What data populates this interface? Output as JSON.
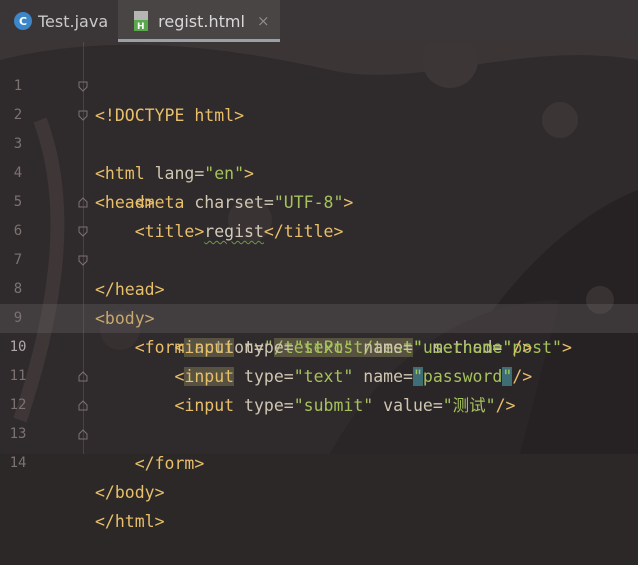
{
  "tabs": [
    {
      "label": "Test.java",
      "icon": "java-class-icon",
      "active": false,
      "close": ""
    },
    {
      "label": "regist.html",
      "icon": "html-file-icon",
      "active": true,
      "close": "×"
    }
  ],
  "editor": {
    "lines": [
      {
        "num": "1"
      },
      {
        "num": "2"
      },
      {
        "num": "3"
      },
      {
        "num": "4"
      },
      {
        "num": "5"
      },
      {
        "num": "6"
      },
      {
        "num": "7"
      },
      {
        "num": "8"
      },
      {
        "num": "9"
      },
      {
        "num": "10"
      },
      {
        "num": "11"
      },
      {
        "num": "12"
      },
      {
        "num": "13"
      },
      {
        "num": "14"
      }
    ],
    "current_line": "10",
    "code": {
      "doctype": "<!DOCTYPE html>",
      "html_open": "<html",
      "lang_attr": "lang",
      "lang_val": "\"en\"",
      "html_close_bracket": ">",
      "head_open": "<head>",
      "meta_open": "<meta",
      "charset_attr": "charset",
      "charset_val": "\"UTF-8\"",
      "meta_close": ">",
      "title_open": "<title>",
      "title_text": "regist",
      "title_close": "</title>",
      "head_close": "</head>",
      "body_open": "<body>",
      "form_open": "<form",
      "action_attr": "action",
      "action_val_q1": "\"",
      "action_val": "/testPost/test",
      "action_val_q2": "\"",
      "method_attr": "method",
      "method_val": "\"post\"",
      "form_open_close": ">",
      "input_lt": "<",
      "input_tag": "input",
      "type_attr": "type",
      "type_text": "\"text\"",
      "name_attr": "name",
      "name_username": "\"username\"",
      "selfclose": "/>",
      "name_password_q1": "\"",
      "name_password": "password",
      "name_password_q2": "\"",
      "input_full": "<input",
      "type_submit": "\"submit\"",
      "value_attr": "value",
      "value_val": "\"测试\"",
      "form_close": "</form>",
      "body_close": "</body>",
      "html_close": "</html>"
    }
  },
  "colors": {
    "tag": "#e8bf6a",
    "string": "#a5c25c",
    "attribute": "#cfc6b2",
    "line_number": "#7d7272"
  }
}
